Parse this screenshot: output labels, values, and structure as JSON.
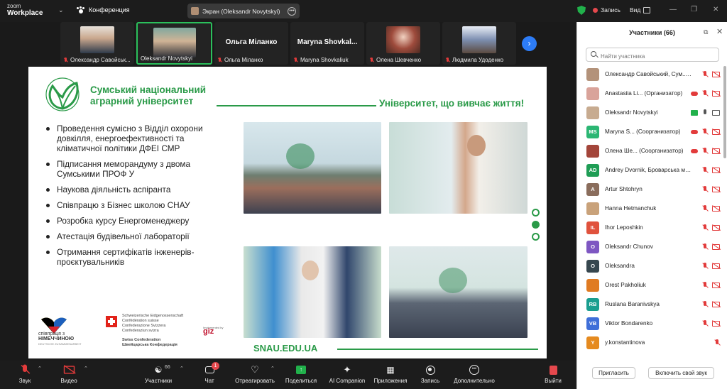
{
  "app": {
    "logo_small": "zoom",
    "logo_big": "Workplace",
    "meeting_title": "Конференция",
    "screen_chip": "Экран (Oleksandr Novytskyi)",
    "record_label": "Запись",
    "view_label": "Вид"
  },
  "thumbnails": [
    {
      "name": "Олександр Савойськ...",
      "type": "photo",
      "color": "#c9a78d"
    },
    {
      "name": "Oleksandr Novytskyi",
      "type": "photo",
      "color": "#d0b496",
      "active": true
    },
    {
      "name": "Ольга Міланко",
      "type": "name",
      "bigname": "Ольга Міланко"
    },
    {
      "name": "Maryna Shovkaliuk",
      "type": "name",
      "bigname": "Maryna Shovkal..."
    },
    {
      "name": "Олена Шевченко",
      "type": "photo",
      "color": "#9e4b3c"
    },
    {
      "name": "Людмила Удоденко",
      "type": "photo",
      "color": "#7d8fb0"
    }
  ],
  "slide": {
    "uni_name_line1": "Сумський національний",
    "uni_name_line2": "аграрний університет",
    "motto": "Університет, що вивчає життя!",
    "bullets": [
      "Проведення сумісно з Відділ охорони довкілля, енергоефективності та кліматичної політики ДФЕІ СМР",
      "Підписання меморандуму з двома Сумськими ПРОФ У",
      "Наукова діяльність аспіранта",
      "Співпрацю з Бізнес школою СНАУ",
      "Розробка курсу Енергоменеджеру",
      "Атестація будівельної лабораторії",
      "Отримання сертифікатів інженерів-проєктувальників"
    ],
    "partner_de_1": "співпраця з",
    "partner_de_2": "НІМЕЧЧИНОЮ",
    "partner_de_3": "DEUTSCHE ZUSAMMENARBEIT",
    "swiss_1": "Schweizerische Eidgenossenschaft",
    "swiss_2": "Confédération suisse",
    "swiss_3": "Confederazione Svizzera",
    "swiss_4": "Confederaziun svizra",
    "swiss_5": "Swiss Confederation",
    "swiss_6": "Швейцарська Конфедерація",
    "giz_impl": "Implemented by",
    "giz": "giz",
    "site": "SNAU.EDU.UA"
  },
  "panel": {
    "title": "Участники (66)",
    "search_placeholder": "Найти участника",
    "invite_label": "Пригласить",
    "unmute_label": "Включить свой звук",
    "participants": [
      {
        "initials": "",
        "color": "#b3927a",
        "name": "Олександр Савойський, Сум... (Я)",
        "mic": "off",
        "video": "off"
      },
      {
        "initials": "",
        "color": "#d9a39a",
        "name": "Anastasiia Li... (Организатор)",
        "mic": "off",
        "video": "off",
        "cloud": true
      },
      {
        "initials": "",
        "color": "#c7ab90",
        "name": "Oleksandr Novytskyi",
        "mic": "on",
        "video": "on",
        "share": true
      },
      {
        "initials": "MS",
        "color": "#2bb673",
        "name": "Maryna S... (Соорганизатор)",
        "mic": "off",
        "video": "off",
        "cloud": true
      },
      {
        "initials": "",
        "color": "#a3453a",
        "name": "Олена Ше... (Соорганизатор)",
        "mic": "off",
        "video": "off",
        "cloud": true
      },
      {
        "initials": "AD",
        "color": "#1f9d55",
        "name": "Andrey Dvornik, Броварська міська ...",
        "mic": "off",
        "video": "off"
      },
      {
        "initials": "A",
        "color": "#8a6d5c",
        "name": "Artur Shtohryn",
        "mic": "off",
        "video": "off"
      },
      {
        "initials": "",
        "color": "#c9a27a",
        "name": "Hanna Hetmanchuk",
        "mic": "off",
        "video": "off"
      },
      {
        "initials": "IL",
        "color": "#e0523d",
        "name": "Ihor Leposhkin",
        "mic": "off",
        "video": "off"
      },
      {
        "initials": "O",
        "color": "#7e57c2",
        "name": "Oleksandr Chunov",
        "mic": "off",
        "video": "off"
      },
      {
        "initials": "O",
        "color": "#37474f",
        "name": "Oleksandra",
        "mic": "off",
        "video": "off"
      },
      {
        "initials": "",
        "color": "#e07b22",
        "name": "Orest Pakholiuk",
        "mic": "off",
        "video": "off"
      },
      {
        "initials": "RB",
        "color": "#1a9e8f",
        "name": "Ruslana Baranivskya",
        "mic": "off",
        "video": "off"
      },
      {
        "initials": "VB",
        "color": "#3f6fd8",
        "name": "Viktor Bondarenko",
        "mic": "off",
        "video": "off"
      },
      {
        "initials": "Y",
        "color": "#e58a1f",
        "name": "y.konstantinova",
        "mic": "off",
        "video": "none"
      }
    ]
  },
  "toolbar": {
    "audio": "Звук",
    "video": "Видео",
    "participants": "Участники",
    "participants_count": "66",
    "chat": "Чат",
    "chat_badge": "1",
    "react": "Отреагировать",
    "share": "Поделиться",
    "companion": "AI Companion",
    "apps": "Приложения",
    "record": "Запись",
    "more": "Дополнительно",
    "leave": "Выйти"
  }
}
